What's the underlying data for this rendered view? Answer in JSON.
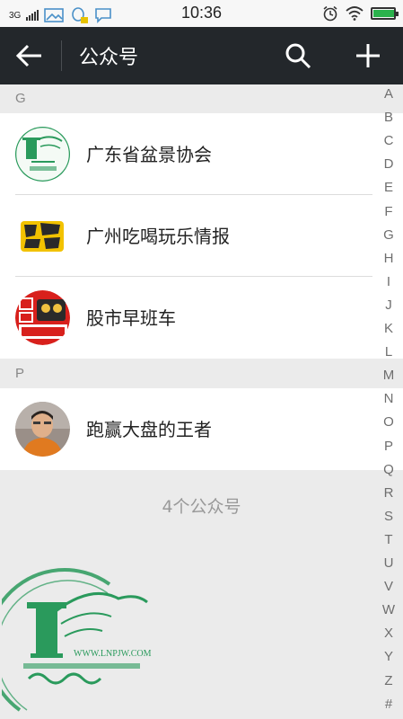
{
  "status_bar": {
    "network": "3G",
    "time": "10:36",
    "battery_level": 0.95
  },
  "header": {
    "title": "公众号"
  },
  "sections": [
    {
      "letter": "G",
      "items": [
        {
          "name": "广东省盆景协会",
          "avatar_icon": "bonsai-association-logo"
        },
        {
          "name": "广州吃喝玩乐情报",
          "avatar_icon": "food-fun-logo"
        },
        {
          "name": "股市早班车",
          "avatar_icon": "stock-morning-bus-logo"
        }
      ]
    },
    {
      "letter": "P",
      "items": [
        {
          "name": "跑赢大盘的王者",
          "avatar_icon": "person-photo"
        }
      ]
    }
  ],
  "footer": {
    "count_text": "4个公众号"
  },
  "index_letters": [
    "A",
    "B",
    "C",
    "D",
    "E",
    "F",
    "G",
    "H",
    "I",
    "J",
    "K",
    "L",
    "M",
    "N",
    "O",
    "P",
    "Q",
    "R",
    "S",
    "T",
    "U",
    "V",
    "W",
    "X",
    "Y",
    "Z",
    "#"
  ],
  "watermark": {
    "url_text": "WWW.LNPJW.COM"
  },
  "colors": {
    "app_bar": "#23272b",
    "background": "#ebebeb",
    "accent_green": "#2a9a5c"
  }
}
